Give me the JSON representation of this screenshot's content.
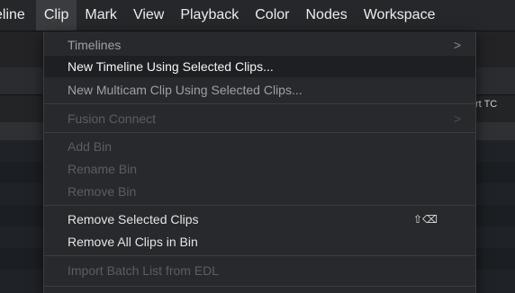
{
  "menubar": {
    "items": [
      {
        "label": "eline"
      },
      {
        "label": "Clip"
      },
      {
        "label": "Mark"
      },
      {
        "label": "View"
      },
      {
        "label": "Playback"
      },
      {
        "label": "Color"
      },
      {
        "label": "Nodes"
      },
      {
        "label": "Workspace"
      }
    ],
    "active_index": 1
  },
  "background": {
    "column_header": "rt TC"
  },
  "clip_menu": {
    "timelines": {
      "label": "Timelines",
      "submenu_arrow": ">"
    },
    "new_timeline": {
      "label": "New Timeline Using Selected Clips..."
    },
    "new_multicam": {
      "label": "New Multicam Clip Using Selected Clips..."
    },
    "fusion_connect": {
      "label": "Fusion Connect",
      "submenu_arrow": ">"
    },
    "add_bin": {
      "label": "Add Bin"
    },
    "rename_bin": {
      "label": "Rename Bin"
    },
    "remove_bin": {
      "label": "Remove Bin"
    },
    "remove_selected": {
      "label": "Remove Selected Clips",
      "shortcut": "⇧⌫"
    },
    "remove_all": {
      "label": "Remove All Clips in Bin"
    },
    "import_batch": {
      "label": "Import Batch List from EDL"
    }
  },
  "colors": {
    "menu_bg": "#28292c",
    "highlight_bg": "#1e1f22",
    "menubar_bg": "#26272a",
    "text_enabled": "#e4e4e4",
    "text_disabled": "#5c5d61"
  }
}
